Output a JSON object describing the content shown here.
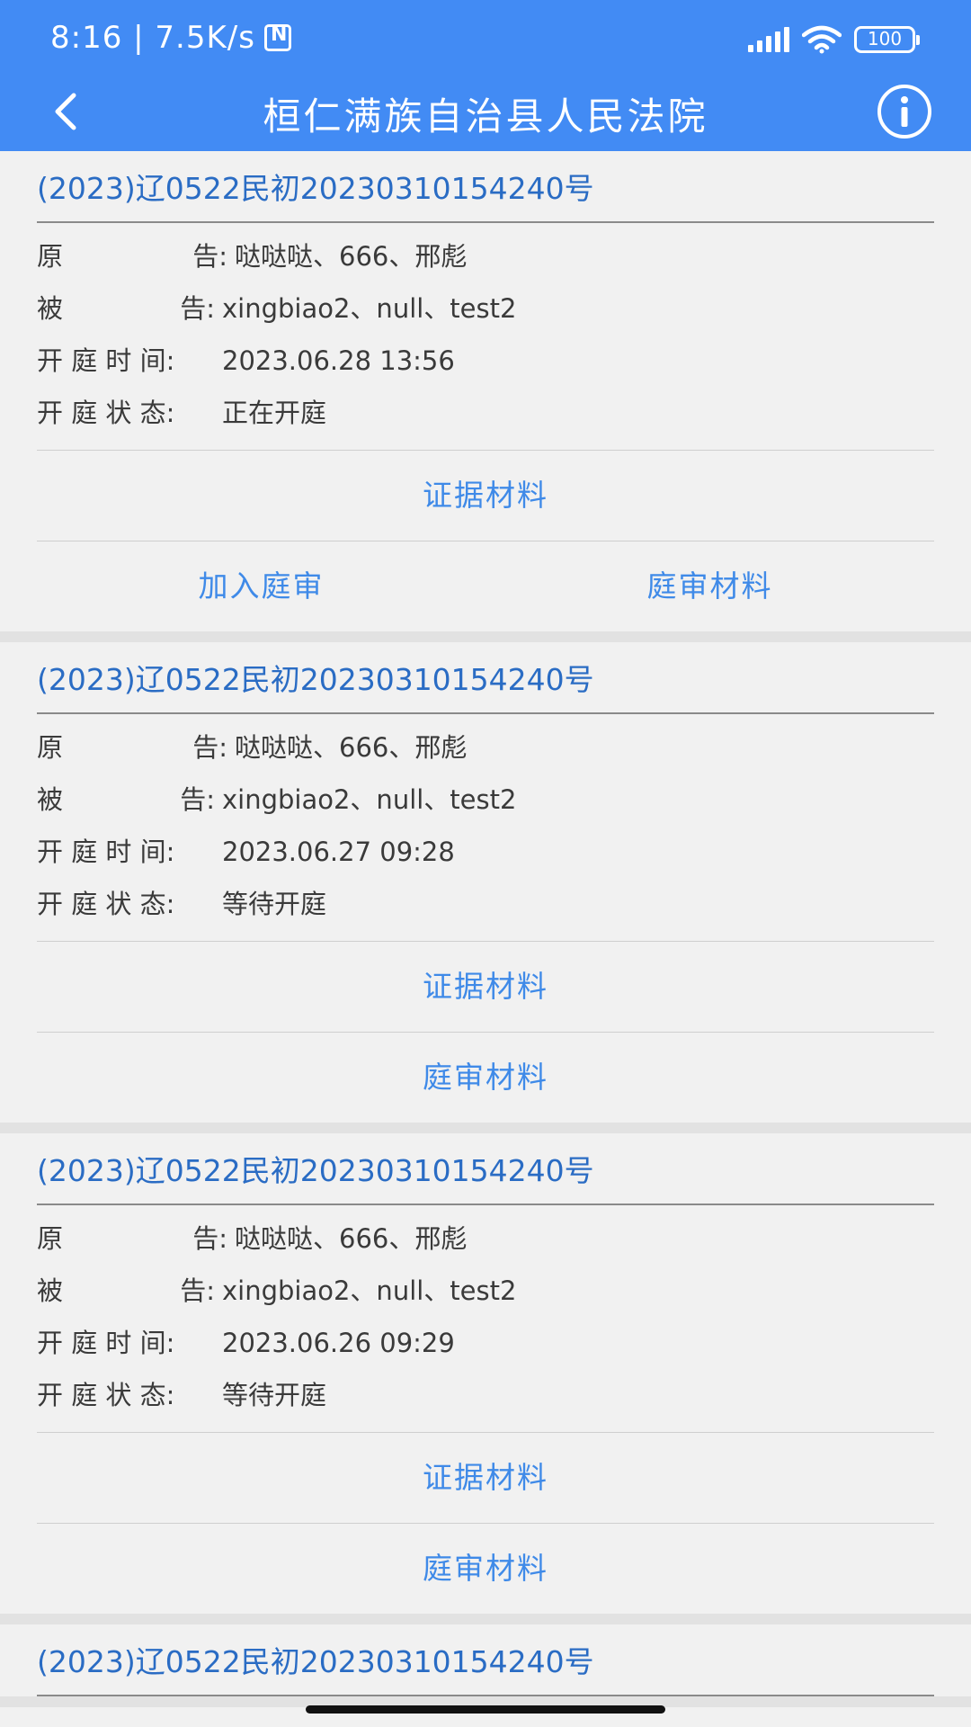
{
  "status_bar": {
    "time_speed": "8:16 | 7.5K/s",
    "battery": "100"
  },
  "header": {
    "title": "桓仁满族自治县人民法院"
  },
  "labels": {
    "plaintiff_a": "原",
    "plaintiff_b": "告:",
    "defendant_a": "被",
    "defendant_b": "告:",
    "time": "开 庭 时 间:",
    "status": "开 庭 状 态:"
  },
  "cases": [
    {
      "title": "(2023)辽0522民初20230310154240号",
      "plaintiff": "哒哒哒、666、邢彪",
      "defendant": "xingbiao2、null、test2",
      "time": "2023.06.28 13:56",
      "status": "正在开庭",
      "evidence": "证据材料",
      "join": "加入庭审",
      "materials": "庭审材料"
    },
    {
      "title": "(2023)辽0522民初20230310154240号",
      "plaintiff": "哒哒哒、666、邢彪",
      "defendant": "xingbiao2、null、test2",
      "time": "2023.06.27 09:28",
      "status": "等待开庭",
      "evidence": "证据材料",
      "materials": "庭审材料"
    },
    {
      "title": "(2023)辽0522民初20230310154240号",
      "plaintiff": "哒哒哒、666、邢彪",
      "defendant": "xingbiao2、null、test2",
      "time": "2023.06.26 09:29",
      "status": "等待开庭",
      "evidence": "证据材料",
      "materials": "庭审材料"
    },
    {
      "title": "(2023)辽0522民初20230310154240号"
    }
  ],
  "icons": {
    "back": "chevron-left-icon",
    "info": "info-circle-icon",
    "signal": "signal-icon",
    "wifi": "wifi-icon",
    "battery": "battery-icon",
    "nfc": "nfc-icon"
  },
  "colors": {
    "header_bg": "#428bf4",
    "case_title": "#2a6cc4",
    "action_text": "#3f8ae8",
    "page_bg": "#f1f1f1"
  }
}
